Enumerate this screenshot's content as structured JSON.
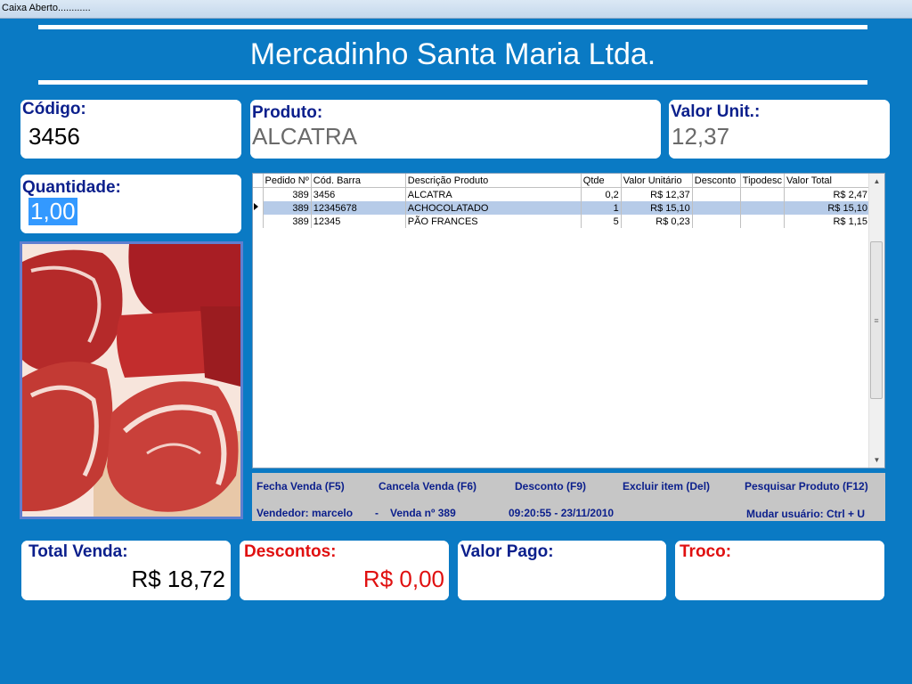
{
  "window": {
    "title": "Caixa Aberto............"
  },
  "store": {
    "name": "Mercadinho Santa Maria Ltda."
  },
  "codigo": {
    "label": "Código:",
    "value": "3456"
  },
  "produto": {
    "label": "Produto:",
    "value": "ALCATRA"
  },
  "valor_unit": {
    "label": "Valor Unit.:",
    "value": "12,37"
  },
  "quantidade": {
    "label": "Quantidade:",
    "value": "1,00"
  },
  "grid": {
    "headers": [
      "Pedido Nº",
      "Cód. Barra",
      "Descrição Produto",
      "Qtde",
      "Valor Unitário",
      "Desconto",
      "Tipodesc",
      "Valor Total"
    ],
    "rows": [
      [
        "389",
        "3456",
        "ALCATRA",
        "0,2",
        "R$ 12,37",
        "",
        "",
        "R$ 2,47"
      ],
      [
        "389",
        "12345678",
        "ACHOCOLATADO",
        "1",
        "R$ 15,10",
        "",
        "",
        "R$ 15,10"
      ],
      [
        "389",
        "12345",
        "PÃO FRANCES",
        "5",
        "R$ 0,23",
        "",
        "",
        "R$ 1,15"
      ]
    ],
    "selected_row": 1
  },
  "shortcuts": {
    "fecha": "Fecha Venda (F5)",
    "cancela": "Cancela Venda (F6)",
    "desconto": "Desconto (F9)",
    "excluir": "Excluir item (Del)",
    "pesquisar": "Pesquisar Produto (F12)"
  },
  "status": {
    "vendedor": "Vendedor: marcelo",
    "sep": "-",
    "venda": "Venda nº 389",
    "datetime": "09:20:55 - 23/11/2010",
    "mudar": "Mudar usuário: Ctrl + U"
  },
  "totals": {
    "total_label": "Total Venda:",
    "total_value": "R$ 18,72",
    "descontos_label": "Descontos:",
    "descontos_value": "R$ 0,00",
    "pago_label": "Valor Pago:",
    "pago_value": "",
    "troco_label": "Troco:",
    "troco_value": ""
  },
  "colors": {
    "background": "#0a7ac4",
    "label": "#0b1f8c",
    "discount": "#e01010",
    "selection": "#3399ff"
  }
}
